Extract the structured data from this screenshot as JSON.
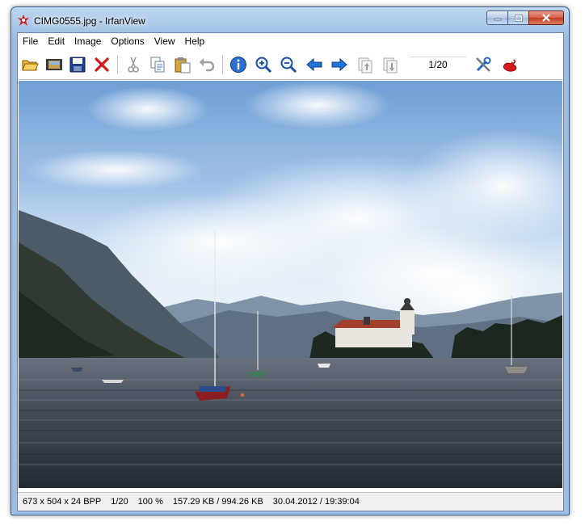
{
  "window": {
    "title": "CIMG0555.jpg - IrfanView"
  },
  "menu": [
    "File",
    "Edit",
    "Image",
    "Options",
    "View",
    "Help"
  ],
  "toolbar": {
    "buttons": [
      "open-folder",
      "thumbnails",
      "save",
      "delete",
      "cut",
      "copy",
      "paste",
      "undo",
      "info",
      "zoom-in",
      "zoom-out",
      "previous",
      "next",
      "page-up",
      "page-down",
      "settings",
      "irfanview-logo"
    ],
    "page_counter": "1/20"
  },
  "statusbar": {
    "dimensions": "673 x 504 x 24 BPP",
    "index": "1/20",
    "zoom": "100 %",
    "size": "157.29 KB / 994.26 KB",
    "datetime": "30.04.2012 / 19:39:04"
  },
  "colors": {
    "accent": "#1e62c7",
    "close_button": "#c8462c",
    "frame": "#a8c6e7"
  }
}
